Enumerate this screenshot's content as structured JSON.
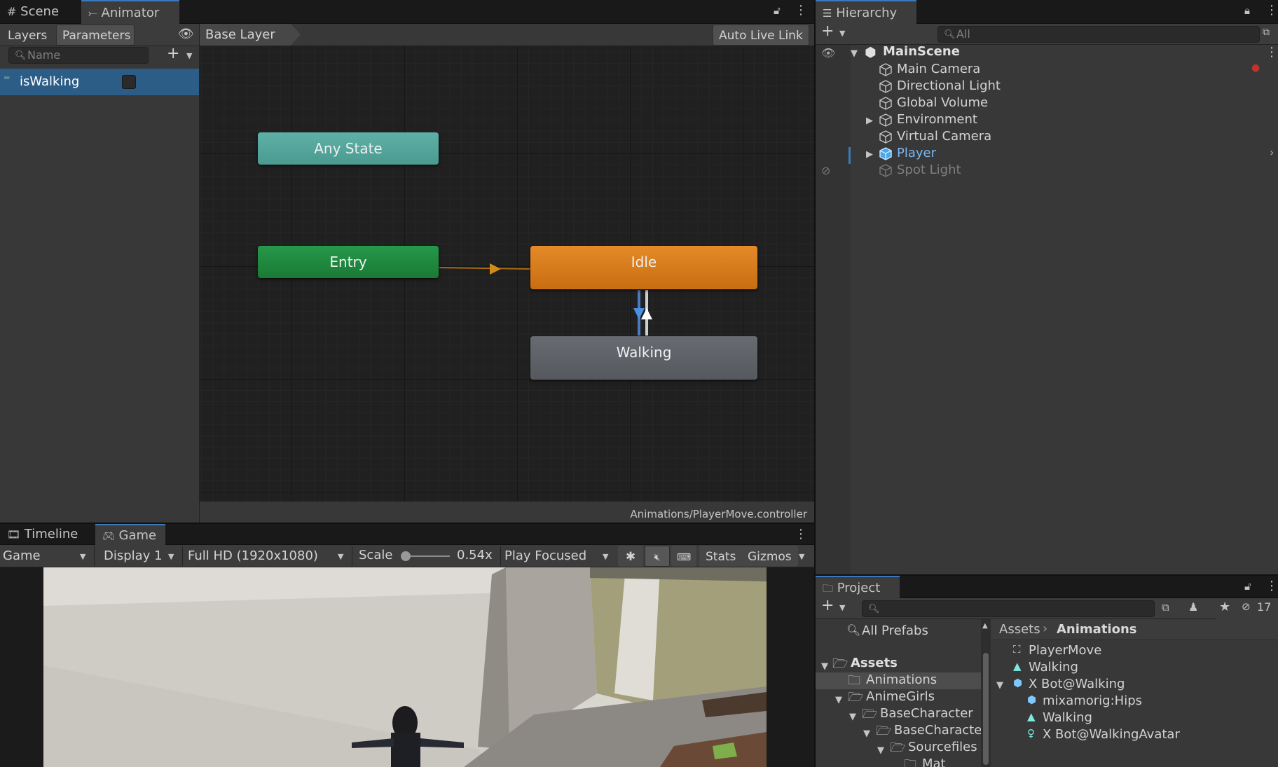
{
  "tabs_top": {
    "scene": "Scene",
    "animator": "Animator",
    "hierarchy": "Hierarchy"
  },
  "animator": {
    "left_tabs": {
      "layers": "Layers",
      "parameters": "Parameters"
    },
    "param_search_placeholder": "Name",
    "parameters": [
      {
        "name": "isWalking",
        "type": "bool",
        "value": false
      }
    ],
    "breadcrumb": "Base Layer",
    "auto_live_link": "Auto Live Link",
    "nodes": {
      "any_state": "Any State",
      "entry": "Entry",
      "idle": "Idle",
      "walking": "Walking"
    },
    "footer_path": "Animations/PlayerMove.controller",
    "colors": {
      "any_state": "#4aa096",
      "entry": "#1e8a3c",
      "idle": "#d77a1c",
      "walking": "#5a5d63",
      "selection": "#2c5d87"
    }
  },
  "hierarchy": {
    "search_placeholder": "All",
    "scene_name": "MainScene",
    "items": [
      {
        "label": "Main Camera",
        "expandable": false,
        "dim": false,
        "highlight": false
      },
      {
        "label": "Directional Light",
        "expandable": false,
        "dim": false,
        "highlight": false
      },
      {
        "label": "Global Volume",
        "expandable": false,
        "dim": false,
        "highlight": false
      },
      {
        "label": "Environment",
        "expandable": true,
        "dim": false,
        "highlight": false
      },
      {
        "label": "Virtual Camera",
        "expandable": false,
        "dim": false,
        "highlight": false
      },
      {
        "label": "Player",
        "expandable": true,
        "dim": false,
        "highlight": true
      },
      {
        "label": "Spot Light",
        "expandable": false,
        "dim": true,
        "highlight": false
      }
    ]
  },
  "bottom_tabs": {
    "timeline": "Timeline",
    "game": "Game"
  },
  "game_toolbar": {
    "mode": "Game",
    "display": "Display 1",
    "resolution": "Full HD (1920x1080)",
    "scale_label": "Scale",
    "scale_value": "0.54x",
    "play_mode": "Play Focused",
    "stats": "Stats",
    "gizmos": "Gizmos"
  },
  "project": {
    "tab": "Project",
    "hidden_count": "17",
    "tree": {
      "all_prefabs": "All Prefabs",
      "assets": "Assets",
      "animations": "Animations",
      "animegirls": "AnimeGirls",
      "basecharacter": "BaseCharacter",
      "basecharacte": "BaseCharacte",
      "sourcefiles": "Sourcefiles",
      "mat": "Mat"
    },
    "breadcrumb": {
      "root": "Assets",
      "current": "Animations"
    },
    "assets": [
      {
        "label": "PlayerMove",
        "kind": "controller"
      },
      {
        "label": "Walking",
        "kind": "clip"
      },
      {
        "label": "X Bot@Walking",
        "kind": "model"
      },
      {
        "label": "mixamorig:Hips",
        "kind": "transform"
      },
      {
        "label": "Walking",
        "kind": "clip"
      },
      {
        "label": "X Bot@WalkingAvatar",
        "kind": "avatar"
      }
    ]
  }
}
